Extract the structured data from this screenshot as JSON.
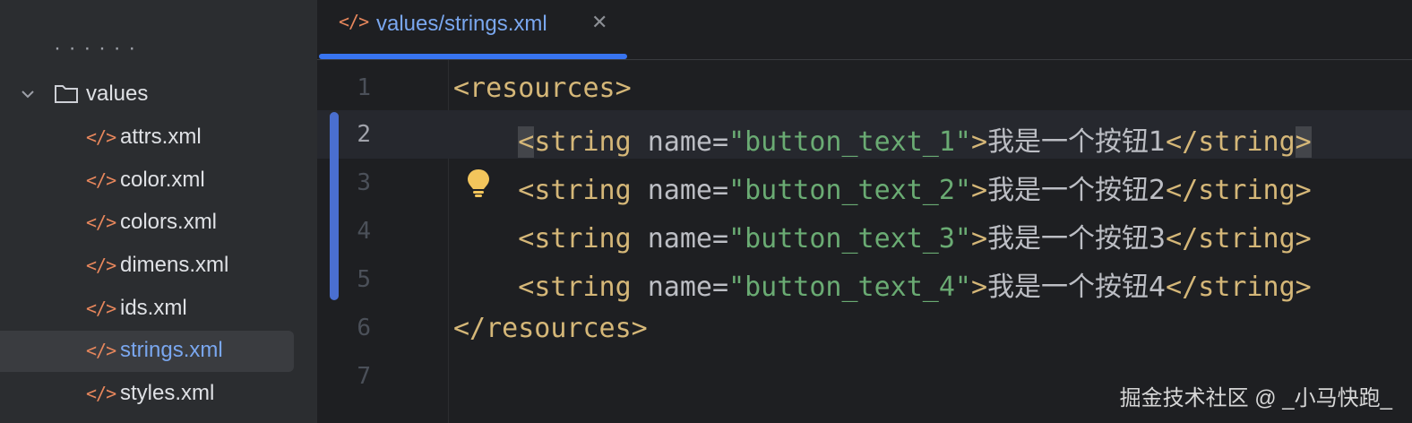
{
  "tab": {
    "label": "values/strings.xml",
    "close": "✕",
    "icon": "</>"
  },
  "sidebar": {
    "truncated_text": "· · · · · ·",
    "folder": {
      "label": "values"
    },
    "files": [
      {
        "icon": "</>",
        "label": "attrs.xml"
      },
      {
        "icon": "</>",
        "label": "color.xml"
      },
      {
        "icon": "</>",
        "label": "colors.xml"
      },
      {
        "icon": "</>",
        "label": "dimens.xml"
      },
      {
        "icon": "</>",
        "label": "ids.xml"
      },
      {
        "icon": "</>",
        "label": "strings.xml",
        "selected": true
      },
      {
        "icon": "</>",
        "label": "styles.xml"
      }
    ]
  },
  "editor": {
    "current_line": 2,
    "lines": [
      {
        "num": "1",
        "open": "<resources>"
      },
      {
        "num": "2",
        "indent": "    ",
        "lt": "<",
        "tag": "string",
        "attr": " name",
        "eq": "=",
        "str": "\"button_text_1\"",
        "gt": ">",
        "text": "我是一个按钮1",
        "close": "</string",
        "end": ">"
      },
      {
        "num": "3",
        "indent": "    ",
        "lt": "<",
        "tag": "string",
        "attr": " name",
        "eq": "=",
        "str": "\"button_text_2\"",
        "gt": ">",
        "text": "我是一个按钮2",
        "close": "</string",
        "end": ">"
      },
      {
        "num": "4",
        "indent": "    ",
        "lt": "<",
        "tag": "string",
        "attr": " name",
        "eq": "=",
        "str": "\"button_text_3\"",
        "gt": ">",
        "text": "我是一个按钮3",
        "close": "</string",
        "end": ">"
      },
      {
        "num": "5",
        "indent": "    ",
        "lt": "<",
        "tag": "string",
        "attr": " name",
        "eq": "=",
        "str": "\"button_text_4\"",
        "gt": ">",
        "text": "我是一个按钮4",
        "close": "</string",
        "end": ">"
      },
      {
        "num": "6",
        "open": "</resources>"
      },
      {
        "num": "7",
        "open": ""
      }
    ]
  },
  "watermark": "掘金技术社区 @ _小马快跑_",
  "colors": {
    "tag": "#d5b778",
    "string": "#6aab73",
    "accent": "#3874f0",
    "xml_icon": "#e8875c"
  }
}
